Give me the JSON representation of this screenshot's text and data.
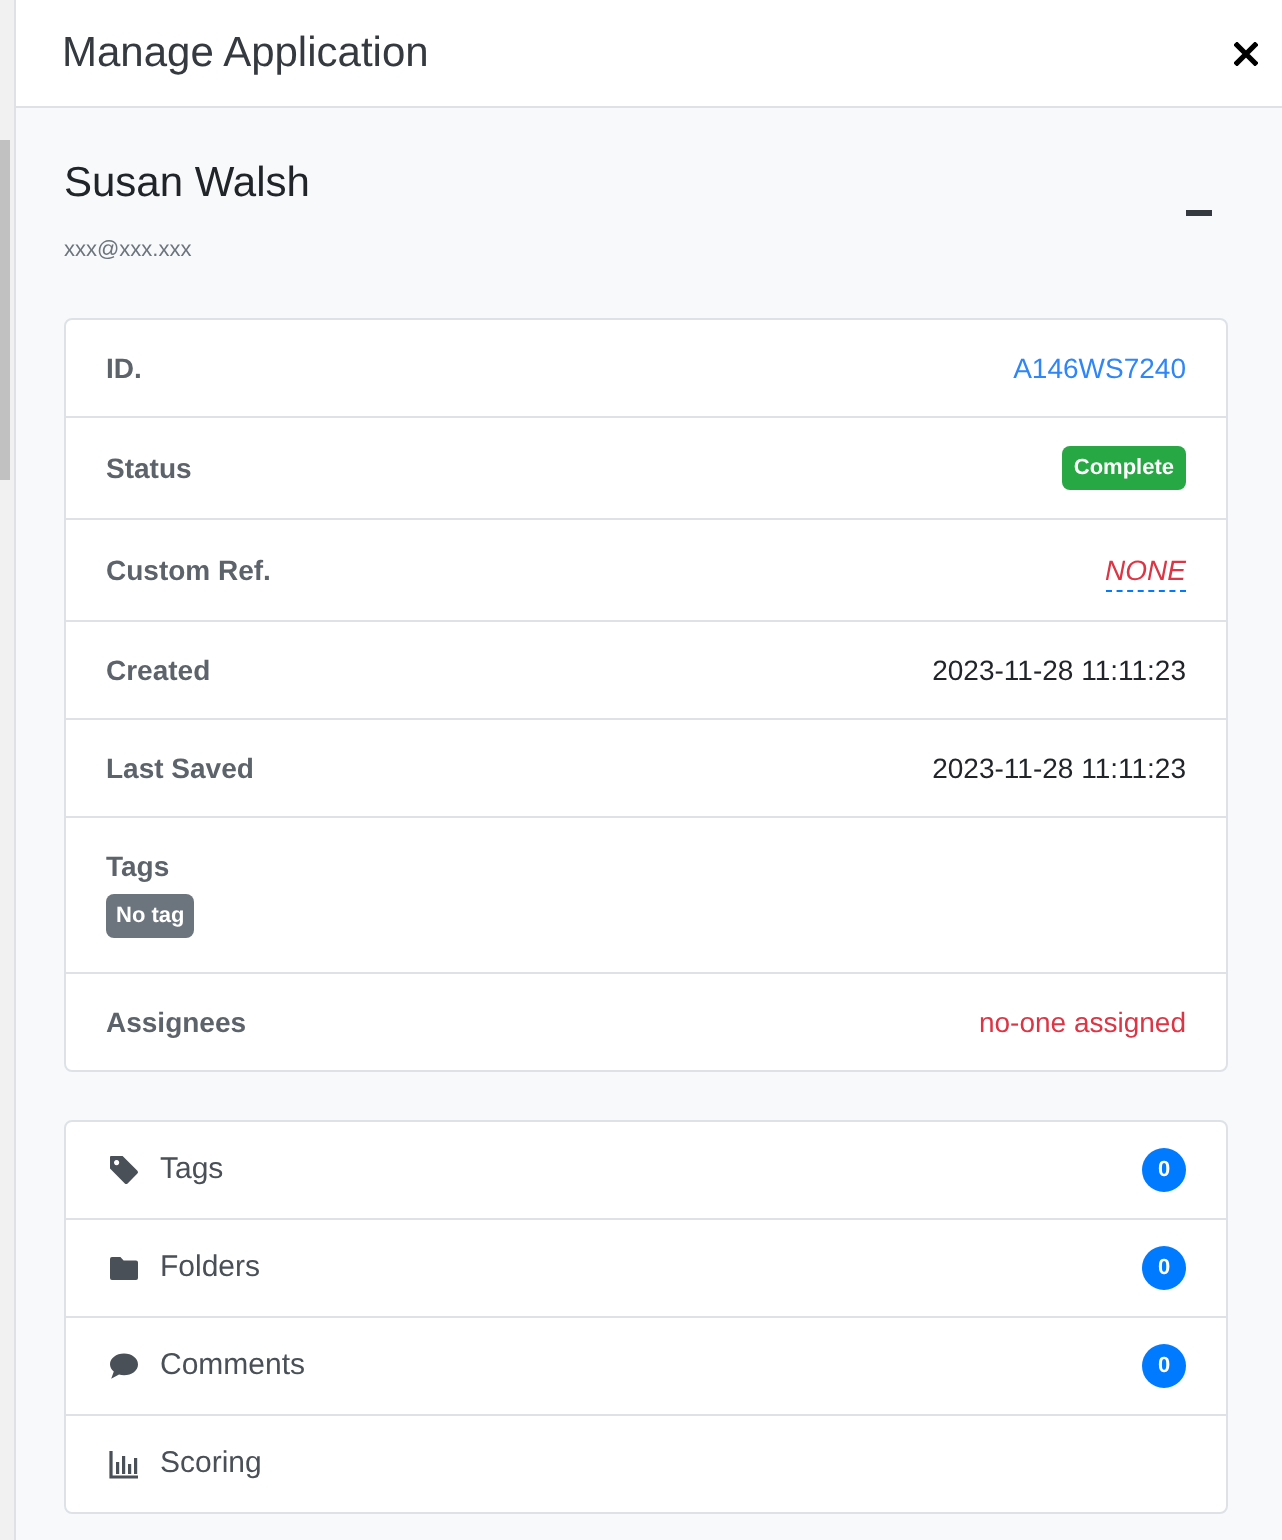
{
  "header": {
    "title": "Manage Application"
  },
  "applicant": {
    "name": "Susan Walsh",
    "email": "xxx@xxx.xxx"
  },
  "details": [
    {
      "kind": "link",
      "label": "ID.",
      "value": "A146WS7240"
    },
    {
      "kind": "badge",
      "label": "Status",
      "value": "Complete"
    },
    {
      "kind": "editable",
      "label": "Custom Ref.",
      "value": "NONE"
    },
    {
      "kind": "text",
      "label": "Created",
      "value": "2023-11-28 11:11:23"
    },
    {
      "kind": "text",
      "label": "Last Saved",
      "value": "2023-11-28 11:11:23"
    },
    {
      "kind": "tags",
      "label": "Tags",
      "tags": [
        "No tag"
      ]
    },
    {
      "kind": "alert",
      "label": "Assignees",
      "value": "no-one assigned"
    }
  ],
  "sections": [
    {
      "kind": "tag",
      "label": "Tags",
      "count": "0"
    },
    {
      "kind": "folder",
      "label": "Folders",
      "count": "0"
    },
    {
      "kind": "comment",
      "label": "Comments",
      "count": "0"
    },
    {
      "kind": "chart",
      "label": "Scoring"
    }
  ]
}
